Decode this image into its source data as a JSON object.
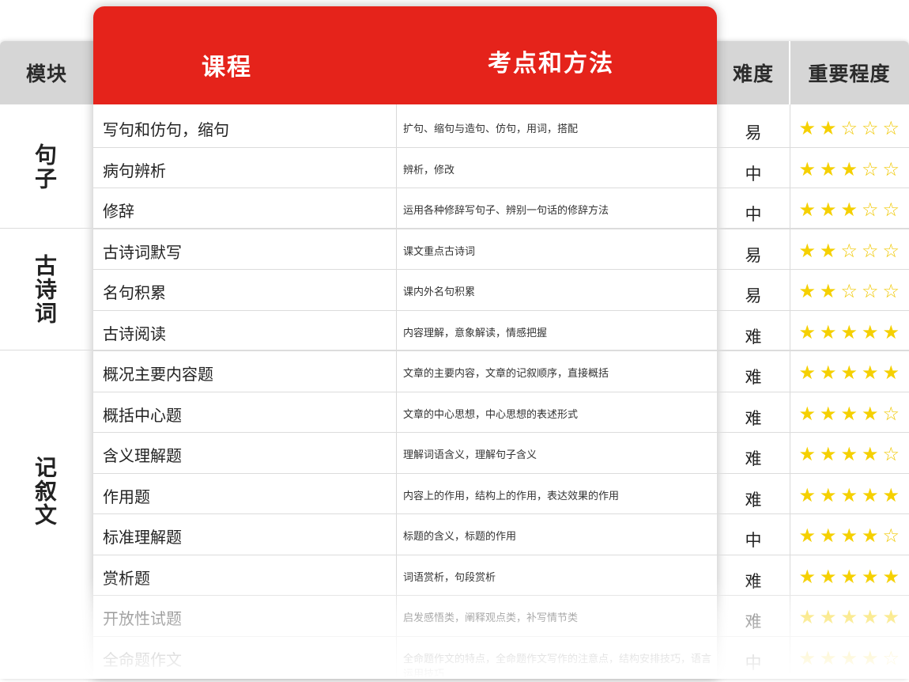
{
  "headers": {
    "module": "模块",
    "course": "课程",
    "method": "考点和方法",
    "difficulty": "难度",
    "importance": "重要程度"
  },
  "modules": [
    {
      "label": "句子"
    },
    {
      "label": "古诗词"
    },
    {
      "label": "记叙文"
    }
  ],
  "rows": [
    {
      "course": "写句和仿句，缩句",
      "method": "扩句、缩句与造句、仿句，用词，搭配",
      "difficulty": "易",
      "stars": 2
    },
    {
      "course": "病句辨析",
      "method": "辨析，修改",
      "difficulty": "中",
      "stars": 3
    },
    {
      "course": "修辞",
      "method": "运用各种修辞写句子、辨别一句话的修辞方法",
      "difficulty": "中",
      "stars": 3
    },
    {
      "course": "古诗词默写",
      "method": "课文重点古诗词",
      "difficulty": "易",
      "stars": 2
    },
    {
      "course": "名句积累",
      "method": "课内外名句积累",
      "difficulty": "易",
      "stars": 2
    },
    {
      "course": "古诗阅读",
      "method": "内容理解，意象解读，情感把握",
      "difficulty": "难",
      "stars": 5
    },
    {
      "course": "概况主要内容题",
      "method": "文章的主要内容，文章的记叙顺序，直接概括",
      "difficulty": "难",
      "stars": 5
    },
    {
      "course": "概括中心题",
      "method": "文章的中心思想，中心思想的表述形式",
      "difficulty": "难",
      "stars": 4
    },
    {
      "course": "含义理解题",
      "method": "理解词语含义，理解句子含义",
      "difficulty": "难",
      "stars": 4
    },
    {
      "course": "作用题",
      "method": "内容上的作用，结构上的作用，表达效果的作用",
      "difficulty": "难",
      "stars": 5
    },
    {
      "course": "标准理解题",
      "method": "标题的含义，标题的作用",
      "difficulty": "中",
      "stars": 4
    },
    {
      "course": "赏析题",
      "method": "词语赏析，句段赏析",
      "difficulty": "难",
      "stars": 5
    },
    {
      "course": "开放性试题",
      "method": "启发感悟类，阐释观点类，补写情节类",
      "difficulty": "难",
      "stars": 5
    },
    {
      "course": "全命题作文",
      "method": "全命题作文的特点，全命题作文写作的注意点，结构安排技巧，语言运用技巧",
      "difficulty": "中",
      "stars": 4
    }
  ],
  "colors": {
    "accent_red": "#e5231b",
    "header_gray": "#d6d6d6",
    "star_yellow": "#f5d000"
  },
  "icons": {
    "filled_star": "star-filled-icon",
    "empty_star": "star-outline-icon"
  }
}
